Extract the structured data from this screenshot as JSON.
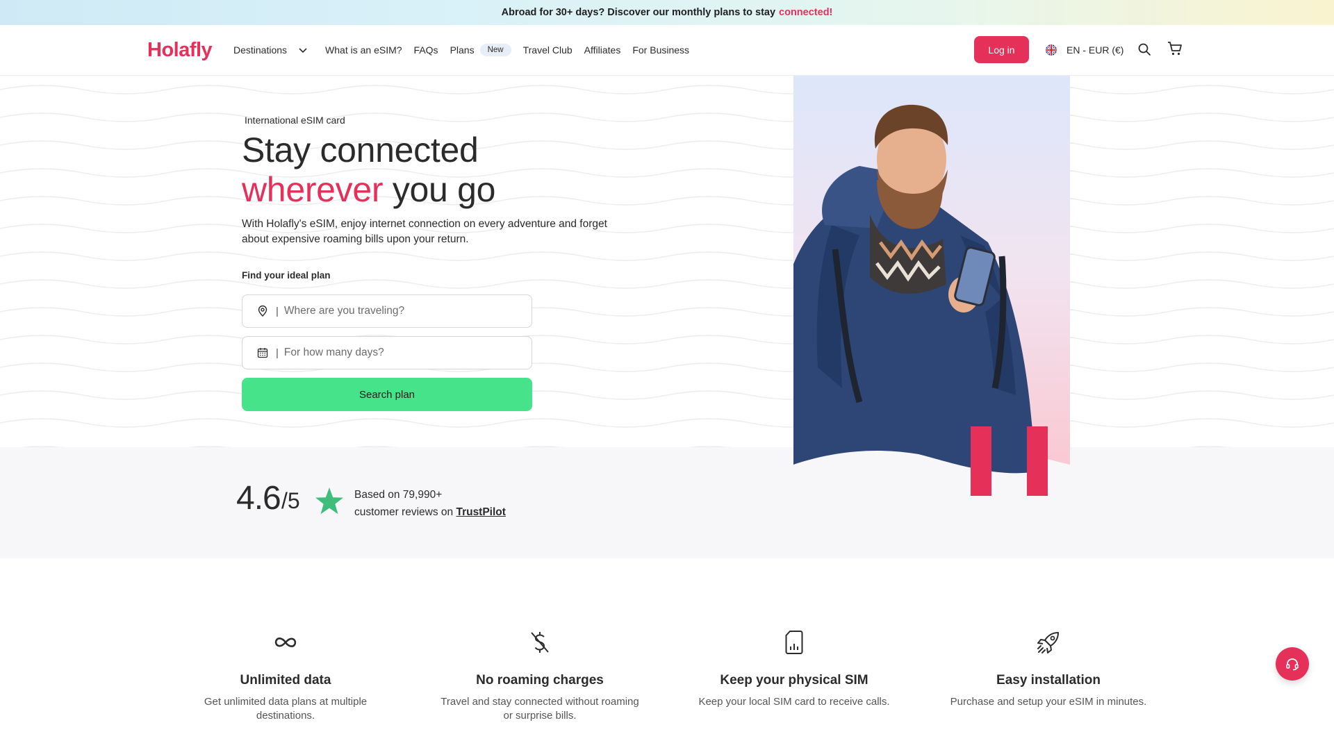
{
  "promo": {
    "text": "Abroad for 30+ days? Discover our monthly plans to stay",
    "accent": "connected!"
  },
  "header": {
    "logo": "Holafly",
    "nav": {
      "destinations": "Destinations",
      "what_is_esim": "What is an eSIM?",
      "faqs": "FAQs",
      "plans": "Plans",
      "plans_badge": "New",
      "travel_club": "Travel Club",
      "affiliates": "Affiliates",
      "for_business": "For Business"
    },
    "login": "Log in",
    "language": "EN - EUR (€)"
  },
  "hero": {
    "eyebrow": "International eSIM card",
    "title_line1": "Stay connected",
    "title_accent": "wherever",
    "title_rest": " you go",
    "subtitle": "With Holafly's eSIM, enjoy internet connection on every adventure and forget about expensive roaming bills upon your return.",
    "find_label": "Find your ideal plan",
    "destination_placeholder": "Where are you traveling?",
    "days_placeholder": "For how many days?",
    "search_button": "Search plan"
  },
  "rating": {
    "score": "4.6",
    "out_of": "/5",
    "line1": "Based on 79,990+",
    "line2": "customer reviews on ",
    "source": "TrustPilot"
  },
  "features": [
    {
      "icon": "infinity-icon",
      "title": "Unlimited data",
      "desc": "Get unlimited data plans at multiple destinations."
    },
    {
      "icon": "no-dollar-icon",
      "title": "No roaming charges",
      "desc": "Travel and stay connected without roaming or surprise bills."
    },
    {
      "icon": "sim-card-icon",
      "title": "Keep your physical SIM",
      "desc": "Keep your local SIM card to receive calls."
    },
    {
      "icon": "rocket-icon",
      "title": "Easy installation",
      "desc": "Purchase and setup your eSIM in minutes."
    }
  ],
  "colors": {
    "brand": "#e5305a",
    "cta": "#47e38a",
    "trustpilot_star": "#3fbd7a"
  }
}
